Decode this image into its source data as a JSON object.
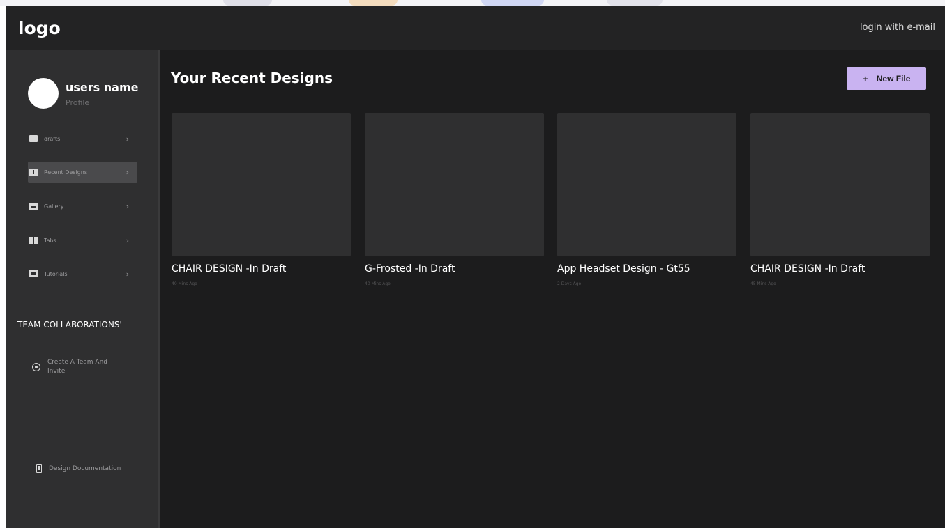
{
  "header": {
    "logo": "logo",
    "login_label": "login with e-mail"
  },
  "profile": {
    "name": "users name",
    "sub_label": "Profile"
  },
  "sidebar": {
    "items": [
      {
        "label": "drafts",
        "icon": "inbox-icon",
        "active": false
      },
      {
        "label": "Recent Designs",
        "icon": "design-icon",
        "active": true
      },
      {
        "label": "Gallery",
        "icon": "gallery-icon",
        "active": false
      },
      {
        "label": "Tabs",
        "icon": "tabs-icon",
        "active": false
      },
      {
        "label": "Tutorials",
        "icon": "tutorial-icon",
        "active": false
      }
    ],
    "chevron": "›",
    "team_title": "TEAM COLLABORATIONS'",
    "team_create_label": "Create A Team And Invite",
    "docs_label": "Design Documentation"
  },
  "main": {
    "title": "Your Recent Designs",
    "new_file_label": "New File",
    "new_file_icon": "+",
    "cards": [
      {
        "title": "CHAIR DESIGN -In Draft",
        "time": "40 Mins Ago"
      },
      {
        "title": "G-Frosted -In Draft",
        "time": "40 Mins Ago"
      },
      {
        "title": "App Headset Design - Gt55",
        "time": "2 Days Ago"
      },
      {
        "title": "CHAIR DESIGN -In Draft",
        "time": "45 Mins Ago"
      }
    ]
  },
  "colors": {
    "accent": "#c9b3f1",
    "background": "#1c1c1d",
    "sidebar": "#2f2f30",
    "header": "#232324"
  }
}
